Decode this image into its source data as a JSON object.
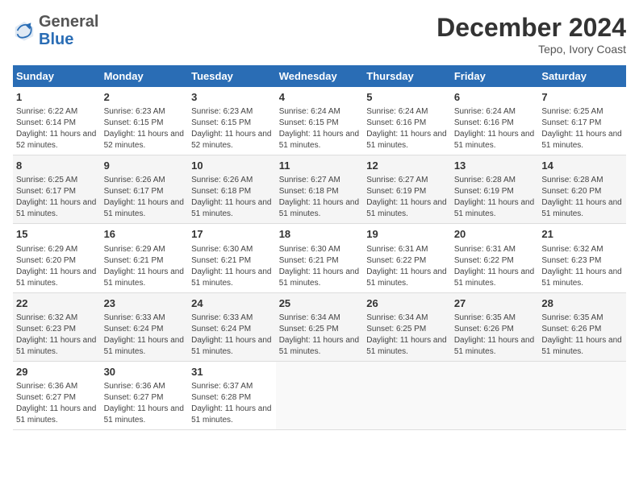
{
  "header": {
    "logo_general": "General",
    "logo_blue": "Blue",
    "month_title": "December 2024",
    "subtitle": "Tepo, Ivory Coast"
  },
  "days_of_week": [
    "Sunday",
    "Monday",
    "Tuesday",
    "Wednesday",
    "Thursday",
    "Friday",
    "Saturday"
  ],
  "weeks": [
    [
      {
        "day": "1",
        "sunrise": "Sunrise: 6:22 AM",
        "sunset": "Sunset: 6:14 PM",
        "daylight": "Daylight: 11 hours and 52 minutes."
      },
      {
        "day": "2",
        "sunrise": "Sunrise: 6:23 AM",
        "sunset": "Sunset: 6:15 PM",
        "daylight": "Daylight: 11 hours and 52 minutes."
      },
      {
        "day": "3",
        "sunrise": "Sunrise: 6:23 AM",
        "sunset": "Sunset: 6:15 PM",
        "daylight": "Daylight: 11 hours and 52 minutes."
      },
      {
        "day": "4",
        "sunrise": "Sunrise: 6:24 AM",
        "sunset": "Sunset: 6:15 PM",
        "daylight": "Daylight: 11 hours and 51 minutes."
      },
      {
        "day": "5",
        "sunrise": "Sunrise: 6:24 AM",
        "sunset": "Sunset: 6:16 PM",
        "daylight": "Daylight: 11 hours and 51 minutes."
      },
      {
        "day": "6",
        "sunrise": "Sunrise: 6:24 AM",
        "sunset": "Sunset: 6:16 PM",
        "daylight": "Daylight: 11 hours and 51 minutes."
      },
      {
        "day": "7",
        "sunrise": "Sunrise: 6:25 AM",
        "sunset": "Sunset: 6:17 PM",
        "daylight": "Daylight: 11 hours and 51 minutes."
      }
    ],
    [
      {
        "day": "8",
        "sunrise": "Sunrise: 6:25 AM",
        "sunset": "Sunset: 6:17 PM",
        "daylight": "Daylight: 11 hours and 51 minutes."
      },
      {
        "day": "9",
        "sunrise": "Sunrise: 6:26 AM",
        "sunset": "Sunset: 6:17 PM",
        "daylight": "Daylight: 11 hours and 51 minutes."
      },
      {
        "day": "10",
        "sunrise": "Sunrise: 6:26 AM",
        "sunset": "Sunset: 6:18 PM",
        "daylight": "Daylight: 11 hours and 51 minutes."
      },
      {
        "day": "11",
        "sunrise": "Sunrise: 6:27 AM",
        "sunset": "Sunset: 6:18 PM",
        "daylight": "Daylight: 11 hours and 51 minutes."
      },
      {
        "day": "12",
        "sunrise": "Sunrise: 6:27 AM",
        "sunset": "Sunset: 6:19 PM",
        "daylight": "Daylight: 11 hours and 51 minutes."
      },
      {
        "day": "13",
        "sunrise": "Sunrise: 6:28 AM",
        "sunset": "Sunset: 6:19 PM",
        "daylight": "Daylight: 11 hours and 51 minutes."
      },
      {
        "day": "14",
        "sunrise": "Sunrise: 6:28 AM",
        "sunset": "Sunset: 6:20 PM",
        "daylight": "Daylight: 11 hours and 51 minutes."
      }
    ],
    [
      {
        "day": "15",
        "sunrise": "Sunrise: 6:29 AM",
        "sunset": "Sunset: 6:20 PM",
        "daylight": "Daylight: 11 hours and 51 minutes."
      },
      {
        "day": "16",
        "sunrise": "Sunrise: 6:29 AM",
        "sunset": "Sunset: 6:21 PM",
        "daylight": "Daylight: 11 hours and 51 minutes."
      },
      {
        "day": "17",
        "sunrise": "Sunrise: 6:30 AM",
        "sunset": "Sunset: 6:21 PM",
        "daylight": "Daylight: 11 hours and 51 minutes."
      },
      {
        "day": "18",
        "sunrise": "Sunrise: 6:30 AM",
        "sunset": "Sunset: 6:21 PM",
        "daylight": "Daylight: 11 hours and 51 minutes."
      },
      {
        "day": "19",
        "sunrise": "Sunrise: 6:31 AM",
        "sunset": "Sunset: 6:22 PM",
        "daylight": "Daylight: 11 hours and 51 minutes."
      },
      {
        "day": "20",
        "sunrise": "Sunrise: 6:31 AM",
        "sunset": "Sunset: 6:22 PM",
        "daylight": "Daylight: 11 hours and 51 minutes."
      },
      {
        "day": "21",
        "sunrise": "Sunrise: 6:32 AM",
        "sunset": "Sunset: 6:23 PM",
        "daylight": "Daylight: 11 hours and 51 minutes."
      }
    ],
    [
      {
        "day": "22",
        "sunrise": "Sunrise: 6:32 AM",
        "sunset": "Sunset: 6:23 PM",
        "daylight": "Daylight: 11 hours and 51 minutes."
      },
      {
        "day": "23",
        "sunrise": "Sunrise: 6:33 AM",
        "sunset": "Sunset: 6:24 PM",
        "daylight": "Daylight: 11 hours and 51 minutes."
      },
      {
        "day": "24",
        "sunrise": "Sunrise: 6:33 AM",
        "sunset": "Sunset: 6:24 PM",
        "daylight": "Daylight: 11 hours and 51 minutes."
      },
      {
        "day": "25",
        "sunrise": "Sunrise: 6:34 AM",
        "sunset": "Sunset: 6:25 PM",
        "daylight": "Daylight: 11 hours and 51 minutes."
      },
      {
        "day": "26",
        "sunrise": "Sunrise: 6:34 AM",
        "sunset": "Sunset: 6:25 PM",
        "daylight": "Daylight: 11 hours and 51 minutes."
      },
      {
        "day": "27",
        "sunrise": "Sunrise: 6:35 AM",
        "sunset": "Sunset: 6:26 PM",
        "daylight": "Daylight: 11 hours and 51 minutes."
      },
      {
        "day": "28",
        "sunrise": "Sunrise: 6:35 AM",
        "sunset": "Sunset: 6:26 PM",
        "daylight": "Daylight: 11 hours and 51 minutes."
      }
    ],
    [
      {
        "day": "29",
        "sunrise": "Sunrise: 6:36 AM",
        "sunset": "Sunset: 6:27 PM",
        "daylight": "Daylight: 11 hours and 51 minutes."
      },
      {
        "day": "30",
        "sunrise": "Sunrise: 6:36 AM",
        "sunset": "Sunset: 6:27 PM",
        "daylight": "Daylight: 11 hours and 51 minutes."
      },
      {
        "day": "31",
        "sunrise": "Sunrise: 6:37 AM",
        "sunset": "Sunset: 6:28 PM",
        "daylight": "Daylight: 11 hours and 51 minutes."
      },
      null,
      null,
      null,
      null
    ]
  ]
}
